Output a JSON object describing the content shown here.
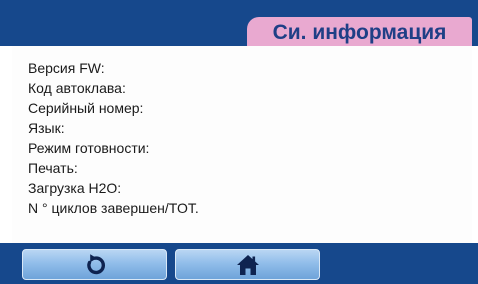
{
  "header": {
    "title": "Си. информация"
  },
  "info": {
    "items": [
      "Версия FW:",
      "Код автоклава:",
      "Серийный номер:",
      "Язык:",
      "Режим готовности:",
      "Печать:",
      "Загрузка H2O:",
      "N ° циклов завершен/TOT."
    ]
  },
  "footer": {
    "buttons": [
      {
        "icon": "refresh-icon"
      },
      {
        "icon": "home-icon"
      }
    ]
  },
  "colors": {
    "frame_blue": "#16488c",
    "title_tab_pink": "#e9a9d0",
    "title_text": "#1f3f86",
    "button_light_blue": "#8fbce9",
    "icon_dark_navy": "#0e2350"
  }
}
